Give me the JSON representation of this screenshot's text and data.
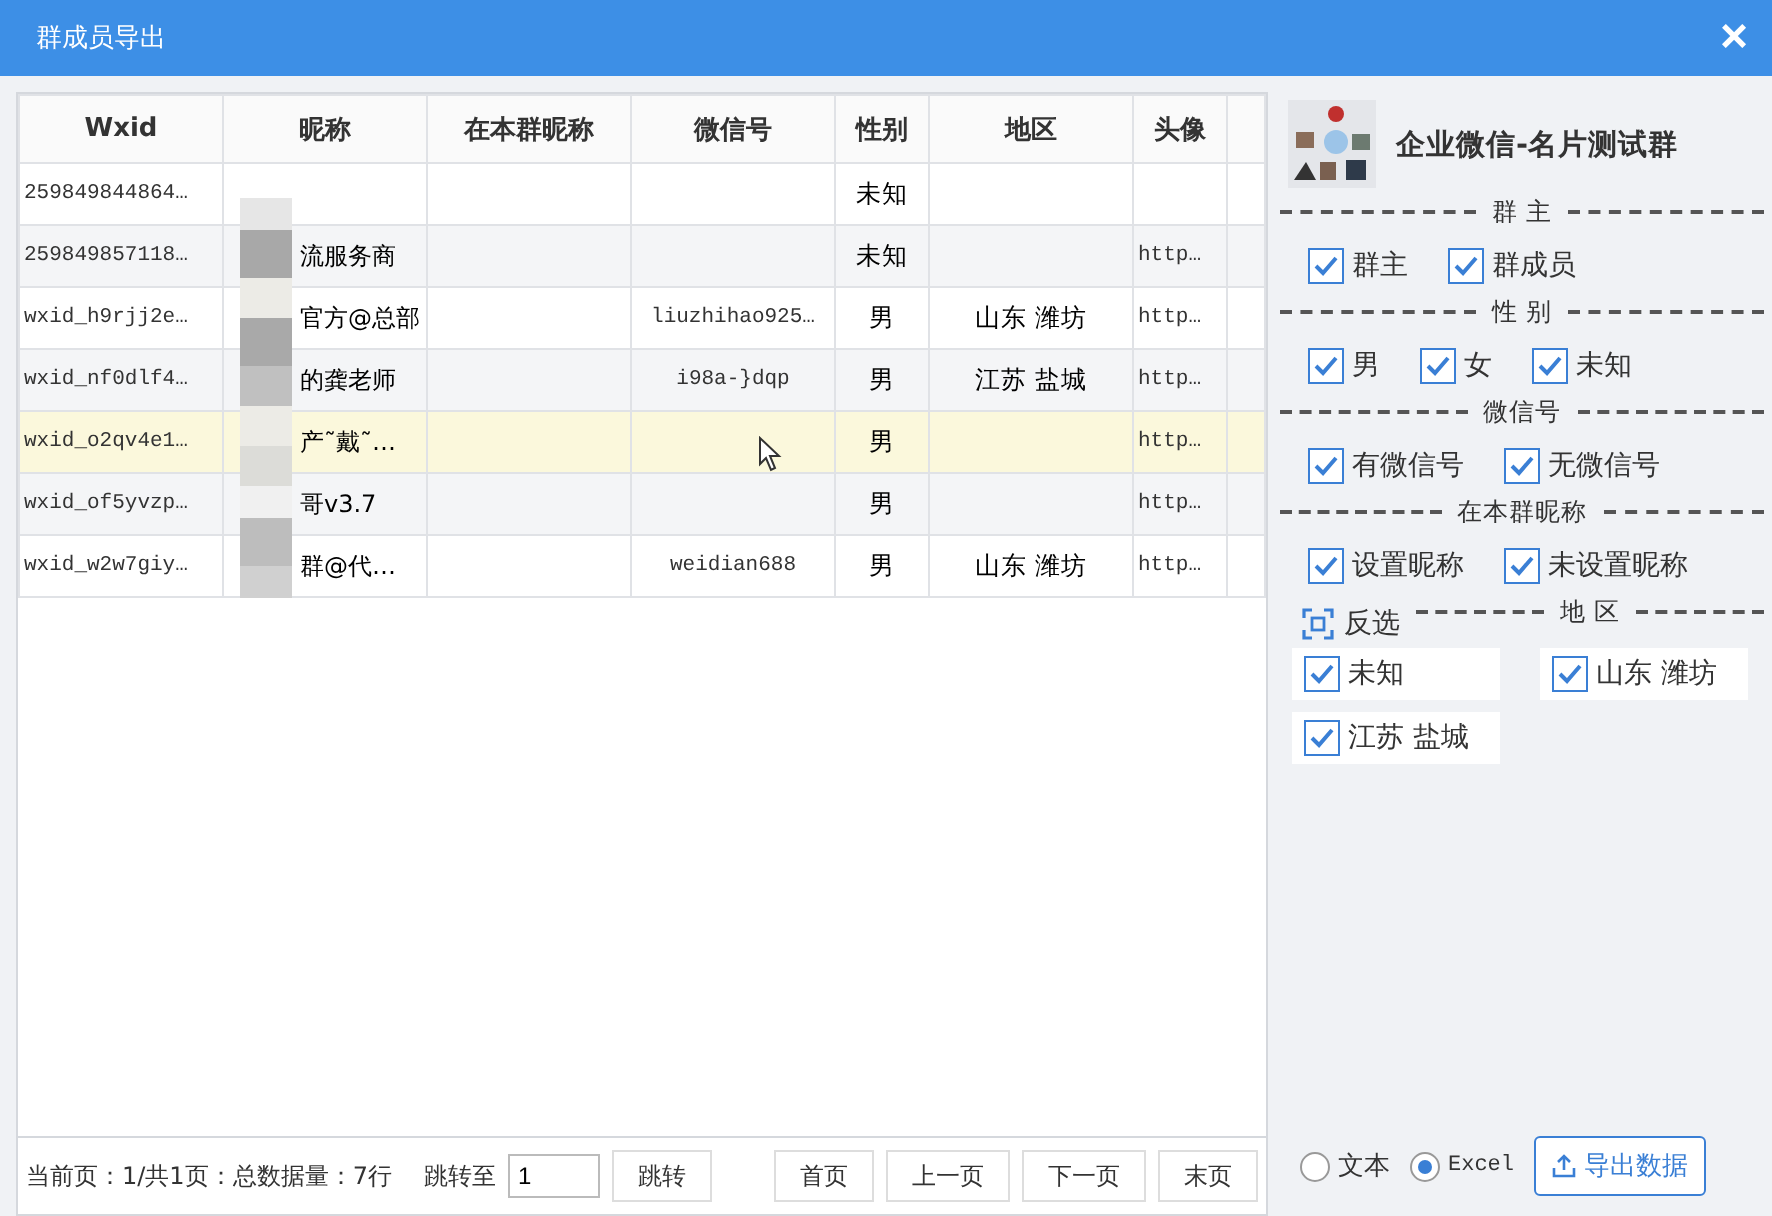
{
  "window": {
    "title": "群成员导出",
    "close": "×"
  },
  "table": {
    "columns": [
      "Wxid",
      "昵称",
      "在本群昵称",
      "微信号",
      "性别",
      "地区",
      "头像"
    ],
    "rows": [
      {
        "selected": false,
        "cells": [
          "259849844864…",
          "",
          "",
          "",
          "未知",
          "",
          ""
        ]
      },
      {
        "selected": false,
        "cells": [
          "259849857118…",
          "流服务商",
          "",
          "",
          "未知",
          "",
          "http…"
        ]
      },
      {
        "selected": false,
        "cells": [
          "wxid_h9rjj2e…",
          "官方@总部",
          "",
          "liuzhihao925…",
          "男",
          "山东 潍坊",
          "http…"
        ]
      },
      {
        "selected": false,
        "cells": [
          "wxid_nf0dlf4…",
          "的龚老师",
          "",
          "i98a-}dqp",
          "男",
          "江苏 盐城",
          "http…"
        ]
      },
      {
        "selected": true,
        "cells": [
          "wxid_o2qv4e1…",
          "产˜戴˜…",
          "",
          "",
          "男",
          "",
          "http…"
        ]
      },
      {
        "selected": false,
        "cells": [
          "wxid_of5yvzp…",
          "哥v3.7",
          "",
          "",
          "男",
          "",
          "http…"
        ]
      },
      {
        "selected": false,
        "cells": [
          "wxid_w2w7giy…",
          "群@代…",
          "",
          "weidian688",
          "男",
          "山东 潍坊",
          "http…"
        ]
      }
    ]
  },
  "pager": {
    "info": "当前页：1/共1页：总数据量：7行",
    "jump_label": "跳转至",
    "page_value": "1",
    "jump_button": "跳转",
    "buttons": [
      "首页",
      "上一页",
      "下一页",
      "末页"
    ]
  },
  "group": {
    "name": "企业微信-名片测试群"
  },
  "filters": [
    {
      "title": "群 主",
      "options": [
        {
          "label": "群主",
          "checked": true
        },
        {
          "label": "群成员",
          "checked": true
        }
      ]
    },
    {
      "title": "性 别",
      "options": [
        {
          "label": "男",
          "checked": true
        },
        {
          "label": "女",
          "checked": true
        },
        {
          "label": "未知",
          "checked": true
        }
      ]
    },
    {
      "title": "微信号",
      "options": [
        {
          "label": "有微信号",
          "checked": true
        },
        {
          "label": "无微信号",
          "checked": true
        }
      ]
    },
    {
      "title": "在本群昵称",
      "options": [
        {
          "label": "设置昵称",
          "checked": true
        },
        {
          "label": "未设置昵称",
          "checked": true
        }
      ]
    },
    {
      "title": "地 区",
      "invert": "反选",
      "boxed": true,
      "options": [
        {
          "label": "未知",
          "checked": true
        },
        {
          "label": "山东 潍坊",
          "checked": true
        },
        {
          "label": "江苏 盐城",
          "checked": true
        }
      ]
    }
  ],
  "export": {
    "formats": [
      {
        "label": "文本",
        "selected": false
      },
      {
        "label": "Excel",
        "selected": true
      }
    ],
    "button": "导出数据"
  }
}
